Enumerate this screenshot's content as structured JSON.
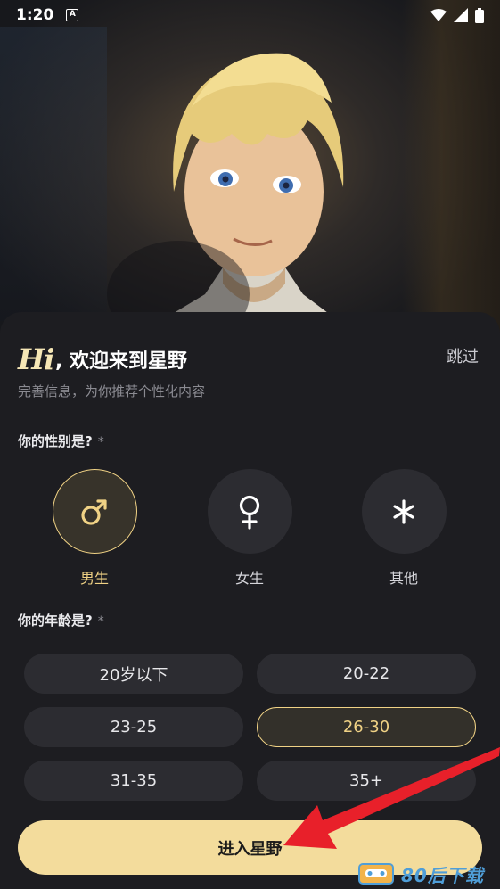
{
  "status": {
    "time": "1:20",
    "notif_letter": "A"
  },
  "header": {
    "hi": "Hi",
    "title": ", 欢迎来到星野",
    "skip_label": "跳过",
    "subtitle": "完善信息，为你推荐个性化内容"
  },
  "gender_section": {
    "label": "你的性别是?",
    "required": "*",
    "options": [
      {
        "label": "男生",
        "icon": "male-icon",
        "selected": true
      },
      {
        "label": "女生",
        "icon": "female-icon",
        "selected": false
      },
      {
        "label": "其他",
        "icon": "asterisk-icon",
        "selected": false
      }
    ]
  },
  "age_section": {
    "label": "你的年龄是?",
    "required": "*",
    "options": [
      {
        "label": "20岁以下",
        "selected": false
      },
      {
        "label": "20-22",
        "selected": false
      },
      {
        "label": "23-25",
        "selected": false
      },
      {
        "label": "26-30",
        "selected": true
      },
      {
        "label": "31-35",
        "selected": false
      },
      {
        "label": "35+",
        "selected": false
      }
    ]
  },
  "enter_button": {
    "label": "进入星野"
  },
  "watermark": {
    "text": "80后下载"
  },
  "colors": {
    "accent": "#f0d285",
    "button_bg": "#f3dc9c",
    "sheet_bg": "#1d1d21",
    "arrow": "#e8202a"
  }
}
